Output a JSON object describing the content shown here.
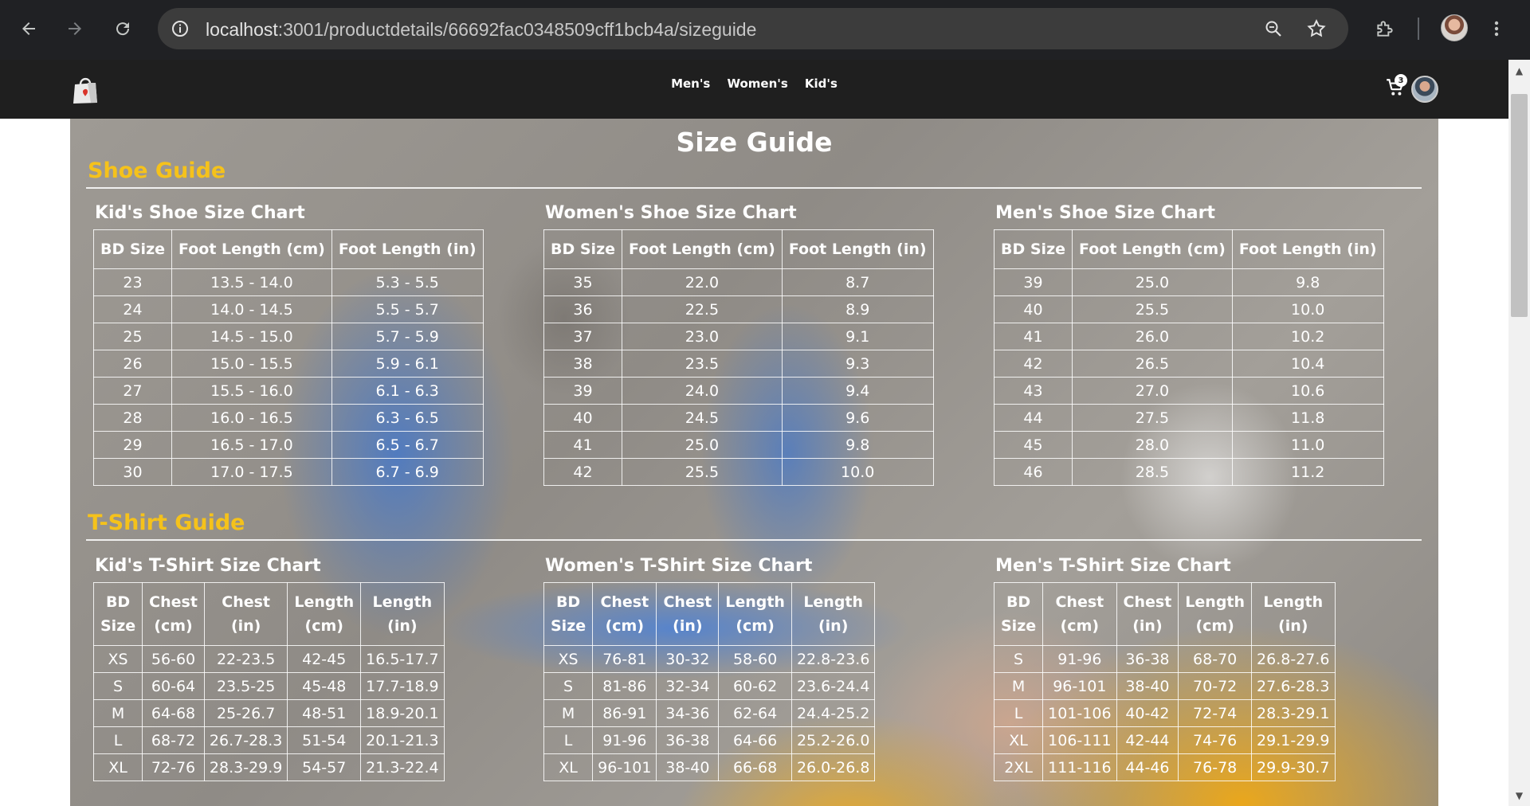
{
  "browser": {
    "url_host": "localhost",
    "url_path": ":3001/productdetails/66692fac0348509cff1bcb4a/sizeguide"
  },
  "site": {
    "nav": [
      "Men's",
      "Women's",
      "Kid's"
    ],
    "cart_count": "3"
  },
  "page": {
    "title": "Size Guide",
    "shoe_guide_title": "Shoe Guide",
    "tshirt_guide_title": "T-Shirt Guide"
  },
  "shoe_charts": [
    {
      "title": "Kid's Shoe Size Chart",
      "headers": [
        "BD Size",
        "Foot Length (cm)",
        "Foot Length (in)"
      ],
      "rows": [
        [
          "23",
          "13.5 - 14.0",
          "5.3 - 5.5"
        ],
        [
          "24",
          "14.0 - 14.5",
          "5.5 - 5.7"
        ],
        [
          "25",
          "14.5 - 15.0",
          "5.7 - 5.9"
        ],
        [
          "26",
          "15.0 - 15.5",
          "5.9 - 6.1"
        ],
        [
          "27",
          "15.5 - 16.0",
          "6.1 - 6.3"
        ],
        [
          "28",
          "16.0 - 16.5",
          "6.3 - 6.5"
        ],
        [
          "29",
          "16.5 - 17.0",
          "6.5 - 6.7"
        ],
        [
          "30",
          "17.0 - 17.5",
          "6.7 - 6.9"
        ]
      ]
    },
    {
      "title": "Women's Shoe Size Chart",
      "headers": [
        "BD Size",
        "Foot Length (cm)",
        "Foot Length (in)"
      ],
      "rows": [
        [
          "35",
          "22.0",
          "8.7"
        ],
        [
          "36",
          "22.5",
          "8.9"
        ],
        [
          "37",
          "23.0",
          "9.1"
        ],
        [
          "38",
          "23.5",
          "9.3"
        ],
        [
          "39",
          "24.0",
          "9.4"
        ],
        [
          "40",
          "24.5",
          "9.6"
        ],
        [
          "41",
          "25.0",
          "9.8"
        ],
        [
          "42",
          "25.5",
          "10.0"
        ]
      ]
    },
    {
      "title": "Men's Shoe Size Chart",
      "headers": [
        "BD Size",
        "Foot Length (cm)",
        "Foot Length (in)"
      ],
      "rows": [
        [
          "39",
          "25.0",
          "9.8"
        ],
        [
          "40",
          "25.5",
          "10.0"
        ],
        [
          "41",
          "26.0",
          "10.2"
        ],
        [
          "42",
          "26.5",
          "10.4"
        ],
        [
          "43",
          "27.0",
          "10.6"
        ],
        [
          "44",
          "27.5",
          "11.8"
        ],
        [
          "45",
          "28.0",
          "11.0"
        ],
        [
          "46",
          "28.5",
          "11.2"
        ]
      ]
    }
  ],
  "tshirt_charts": [
    {
      "title": "Kid's T-Shirt Size Chart",
      "headers": [
        [
          "BD",
          "Size"
        ],
        [
          "Chest",
          "(cm)"
        ],
        [
          "Chest",
          "(in)"
        ],
        [
          "Length",
          "(cm)"
        ],
        [
          "Length",
          "(in)"
        ]
      ],
      "rows": [
        [
          "XS",
          "56-60",
          "22-23.5",
          "42-45",
          "16.5-17.7"
        ],
        [
          "S",
          "60-64",
          "23.5-25",
          "45-48",
          "17.7-18.9"
        ],
        [
          "M",
          "64-68",
          "25-26.7",
          "48-51",
          "18.9-20.1"
        ],
        [
          "L",
          "68-72",
          "26.7-28.3",
          "51-54",
          "20.1-21.3"
        ],
        [
          "XL",
          "72-76",
          "28.3-29.9",
          "54-57",
          "21.3-22.4"
        ]
      ]
    },
    {
      "title": "Women's T-Shirt Size Chart",
      "headers": [
        [
          "BD",
          "Size"
        ],
        [
          "Chest",
          "(cm)"
        ],
        [
          "Chest",
          "(in)"
        ],
        [
          "Length",
          "(cm)"
        ],
        [
          "Length",
          "(in)"
        ]
      ],
      "rows": [
        [
          "XS",
          "76-81",
          "30-32",
          "58-60",
          "22.8-23.6"
        ],
        [
          "S",
          "81-86",
          "32-34",
          "60-62",
          "23.6-24.4"
        ],
        [
          "M",
          "86-91",
          "34-36",
          "62-64",
          "24.4-25.2"
        ],
        [
          "L",
          "91-96",
          "36-38",
          "64-66",
          "25.2-26.0"
        ],
        [
          "XL",
          "96-101",
          "38-40",
          "66-68",
          "26.0-26.8"
        ]
      ]
    },
    {
      "title": "Men's T-Shirt Size Chart",
      "headers": [
        [
          "BD",
          "Size"
        ],
        [
          "Chest",
          "(cm)"
        ],
        [
          "Chest",
          "(in)"
        ],
        [
          "Length",
          "(cm)"
        ],
        [
          "Length",
          "(in)"
        ]
      ],
      "rows": [
        [
          "S",
          "91-96",
          "36-38",
          "68-70",
          "26.8-27.6"
        ],
        [
          "M",
          "96-101",
          "38-40",
          "70-72",
          "27.6-28.3"
        ],
        [
          "L",
          "101-106",
          "40-42",
          "72-74",
          "28.3-29.1"
        ],
        [
          "XL",
          "106-111",
          "42-44",
          "74-76",
          "29.1-29.9"
        ],
        [
          "2XL",
          "111-116",
          "44-46",
          "76-78",
          "29.9-30.7"
        ]
      ]
    }
  ]
}
